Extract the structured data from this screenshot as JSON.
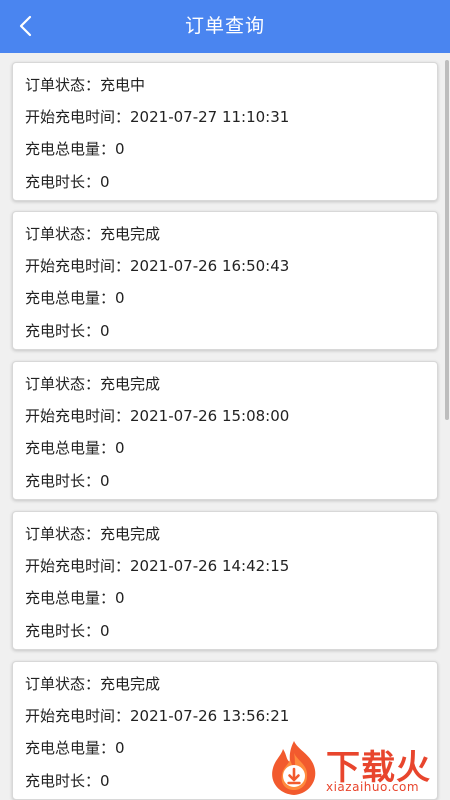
{
  "header": {
    "title": "订单查询",
    "back_icon": "chevron-left-icon",
    "color": "#4a85f0"
  },
  "orders": [
    {
      "status_label": "订单状态：",
      "status": "充电中",
      "start_label": "开始充电时间：",
      "start_time": "2021-07-27 11:10:31",
      "energy_label": "充电总电量：",
      "energy": "0",
      "duration_label": "充电时长：",
      "duration": "0"
    },
    {
      "status_label": "订单状态：",
      "status": "充电完成",
      "start_label": "开始充电时间：",
      "start_time": "2021-07-26 16:50:43",
      "energy_label": "充电总电量：",
      "energy": "0",
      "duration_label": "充电时长：",
      "duration": "0"
    },
    {
      "status_label": "订单状态：",
      "status": "充电完成",
      "start_label": "开始充电时间：",
      "start_time": "2021-07-26 15:08:00",
      "energy_label": "充电总电量：",
      "energy": "0",
      "duration_label": "充电时长：",
      "duration": "0"
    },
    {
      "status_label": "订单状态：",
      "status": "充电完成",
      "start_label": "开始充电时间：",
      "start_time": "2021-07-26 14:42:15",
      "energy_label": "充电总电量：",
      "energy": "0",
      "duration_label": "充电时长：",
      "duration": "0"
    },
    {
      "status_label": "订单状态：",
      "status": "充电完成",
      "start_label": "开始充电时间：",
      "start_time": "2021-07-26 13:56:21",
      "energy_label": "充电总电量：",
      "energy": "0",
      "duration_label": "充电时长：",
      "duration": "0"
    }
  ],
  "watermark": {
    "name": "下载火",
    "url": "xiazaihuo.com",
    "logo_icon": "flame-download-icon",
    "color": "#e8452d"
  }
}
